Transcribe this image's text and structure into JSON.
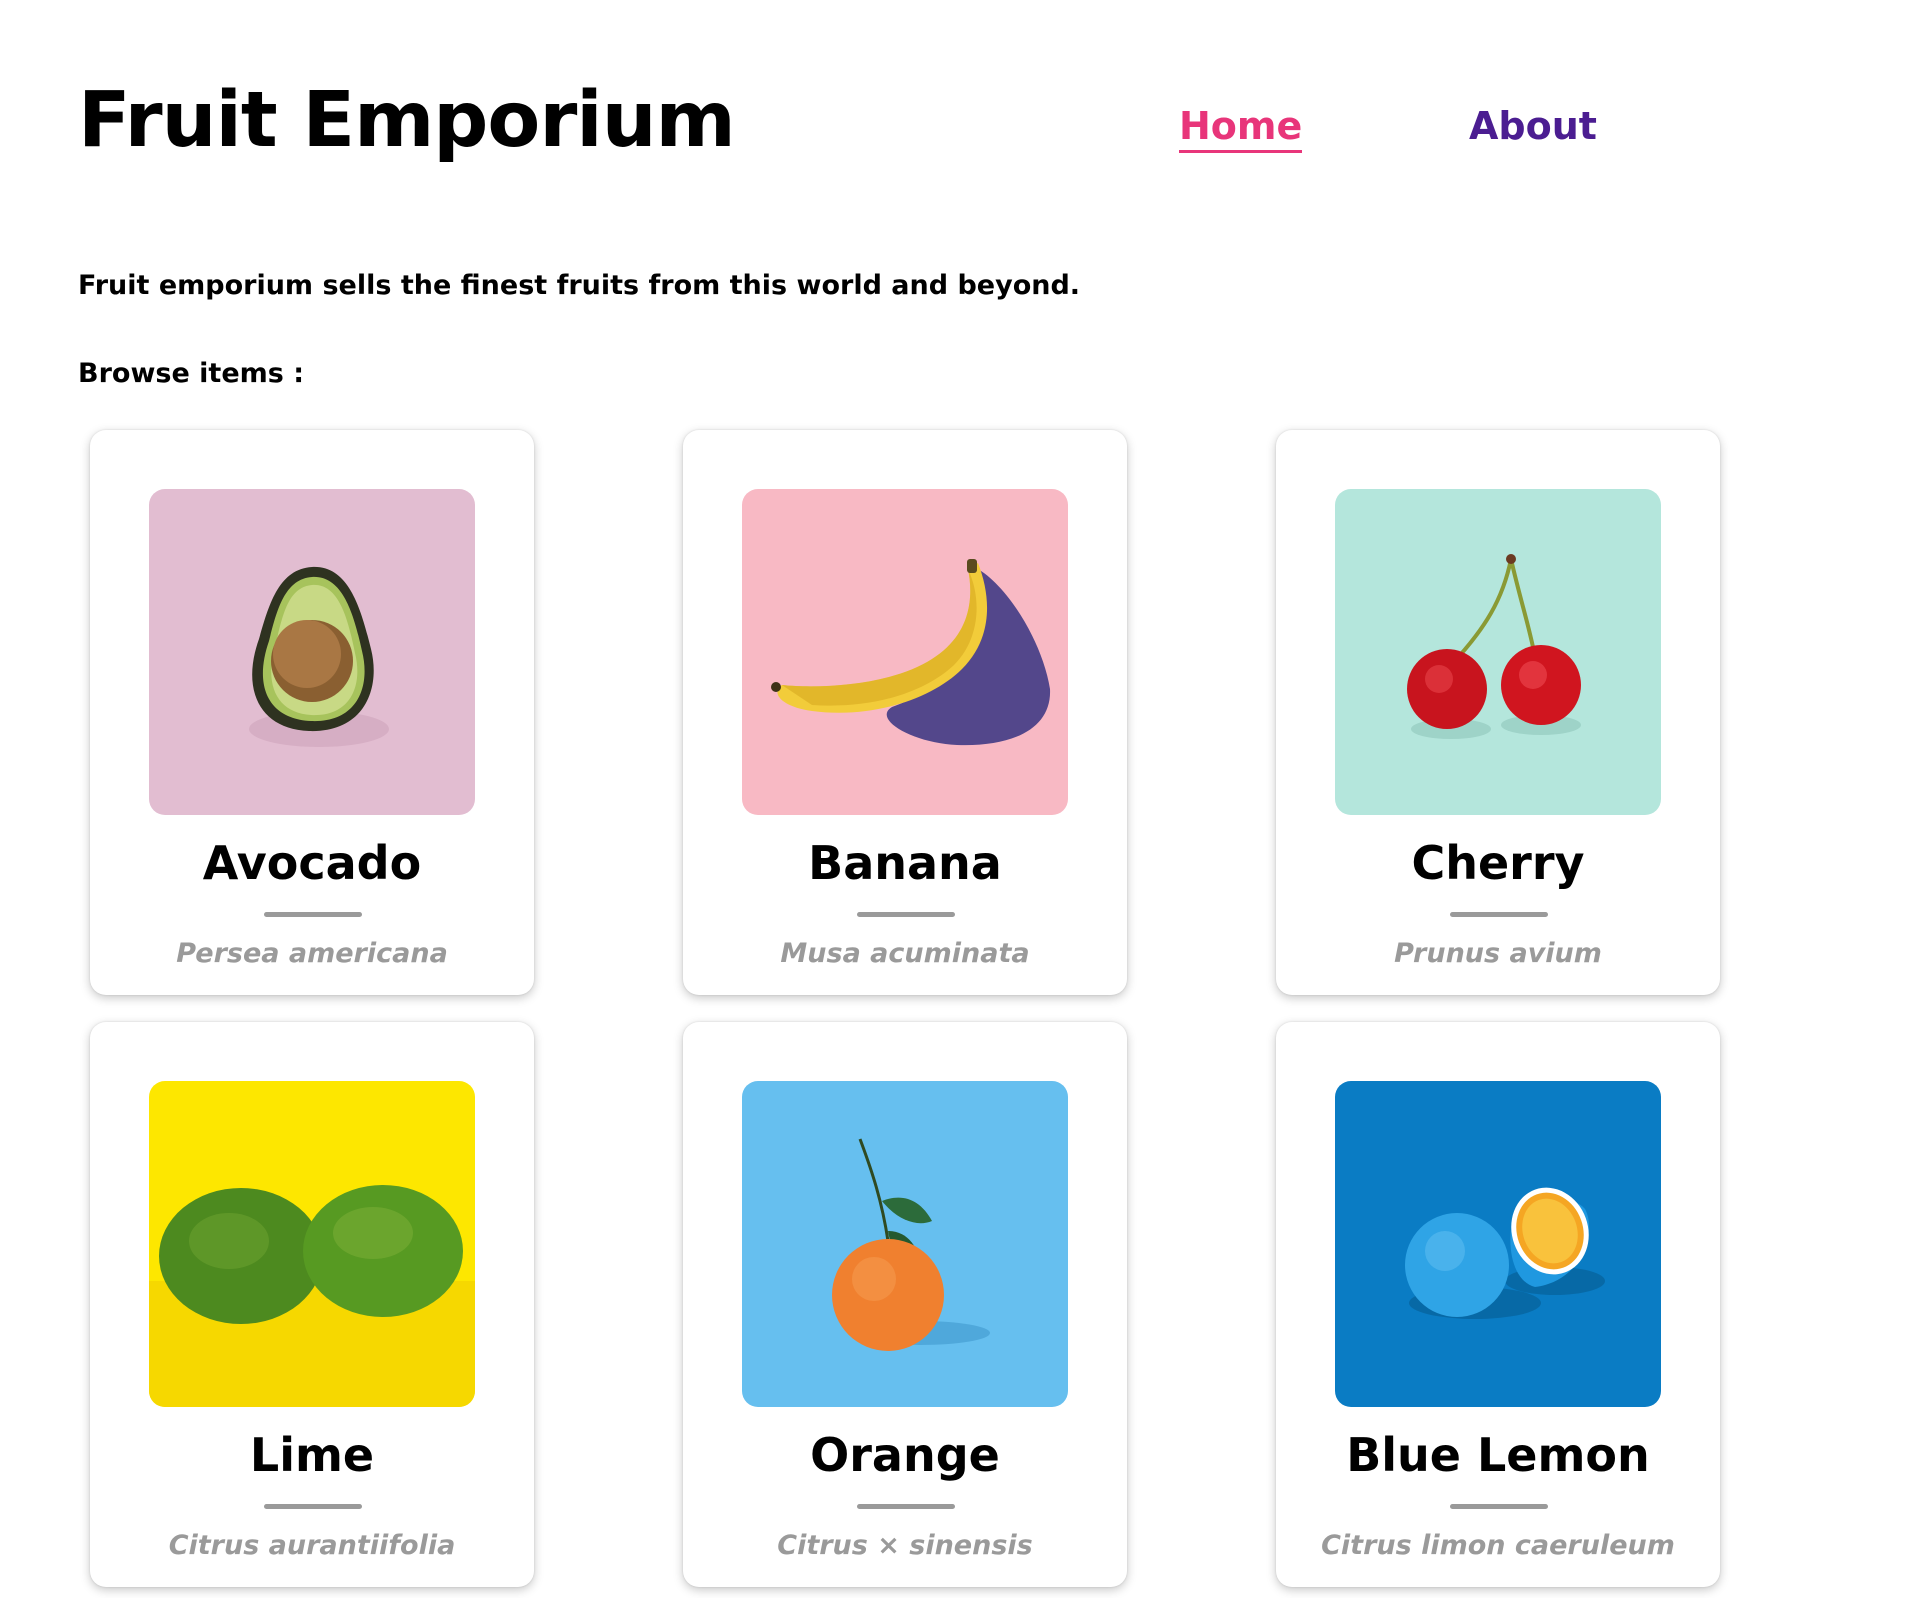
{
  "header": {
    "site_title": "Fruit Emporium",
    "nav": [
      {
        "label": "Home",
        "active": true,
        "color": "#e8357a"
      },
      {
        "label": "About",
        "active": false,
        "color": "#4b1d91"
      }
    ]
  },
  "intro_text": "Fruit emporium sells the finest fruits from this world and beyond.",
  "browse_label": "Browse items :",
  "items": [
    {
      "name": "Avocado",
      "latin": "Persea americana",
      "icon": "avocado-image",
      "bg": "#e2bdd1"
    },
    {
      "name": "Banana",
      "latin": "Musa acuminata",
      "icon": "banana-image",
      "bg": "#f8b9c4"
    },
    {
      "name": "Cherry",
      "latin": "Prunus avium",
      "icon": "cherry-image",
      "bg": "#b4e6dc"
    },
    {
      "name": "Lime",
      "latin": "Citrus aurantiifolia",
      "icon": "lime-image",
      "bg": "#fde700"
    },
    {
      "name": "Orange",
      "latin": "Citrus × sinensis",
      "icon": "orange-image",
      "bg": "#66bfef"
    },
    {
      "name": "Blue Lemon",
      "latin": "Citrus limon caeruleum",
      "icon": "blue-lemon-image",
      "bg": "#0a7cc4"
    }
  ]
}
